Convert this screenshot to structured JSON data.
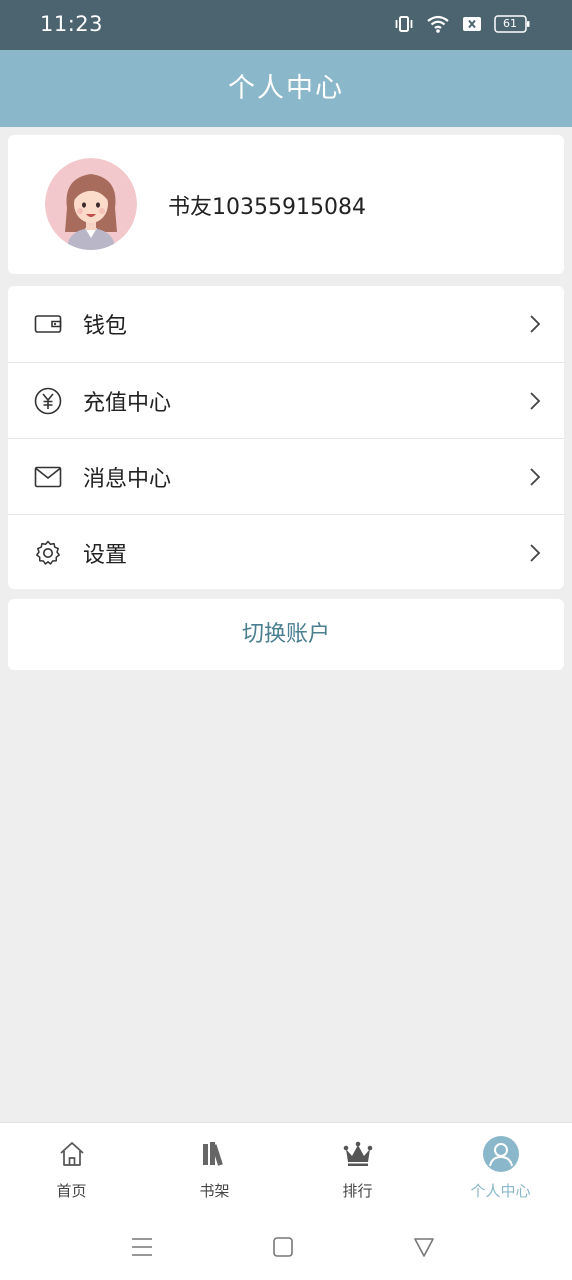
{
  "status_bar": {
    "time": "11:23",
    "battery": "61",
    "icons": [
      "vibrate-icon",
      "wifi-icon",
      "sim-error-icon",
      "battery-icon"
    ]
  },
  "header": {
    "title": "个人中心"
  },
  "profile": {
    "username": "书友10355915084",
    "avatar_icon": "avatar-woman"
  },
  "menu": {
    "items": [
      {
        "label": "钱包",
        "icon": "wallet-icon"
      },
      {
        "label": "充值中心",
        "icon": "yuan-coin-icon"
      },
      {
        "label": "消息中心",
        "icon": "mail-icon"
      },
      {
        "label": "设置",
        "icon": "gear-icon"
      }
    ]
  },
  "switch_account": {
    "label": "切换账户"
  },
  "tab_bar": {
    "tabs": [
      {
        "label": "首页",
        "icon": "home-icon",
        "active": false
      },
      {
        "label": "书架",
        "icon": "bookshelf-icon",
        "active": false
      },
      {
        "label": "排行",
        "icon": "crown-icon",
        "active": false
      },
      {
        "label": "个人中心",
        "icon": "person-icon",
        "active": true
      }
    ]
  },
  "colors": {
    "status_bar": "#4c6470",
    "header": "#8ab8ca",
    "accent_text": "#4a7f90",
    "background": "#eeeeee"
  }
}
